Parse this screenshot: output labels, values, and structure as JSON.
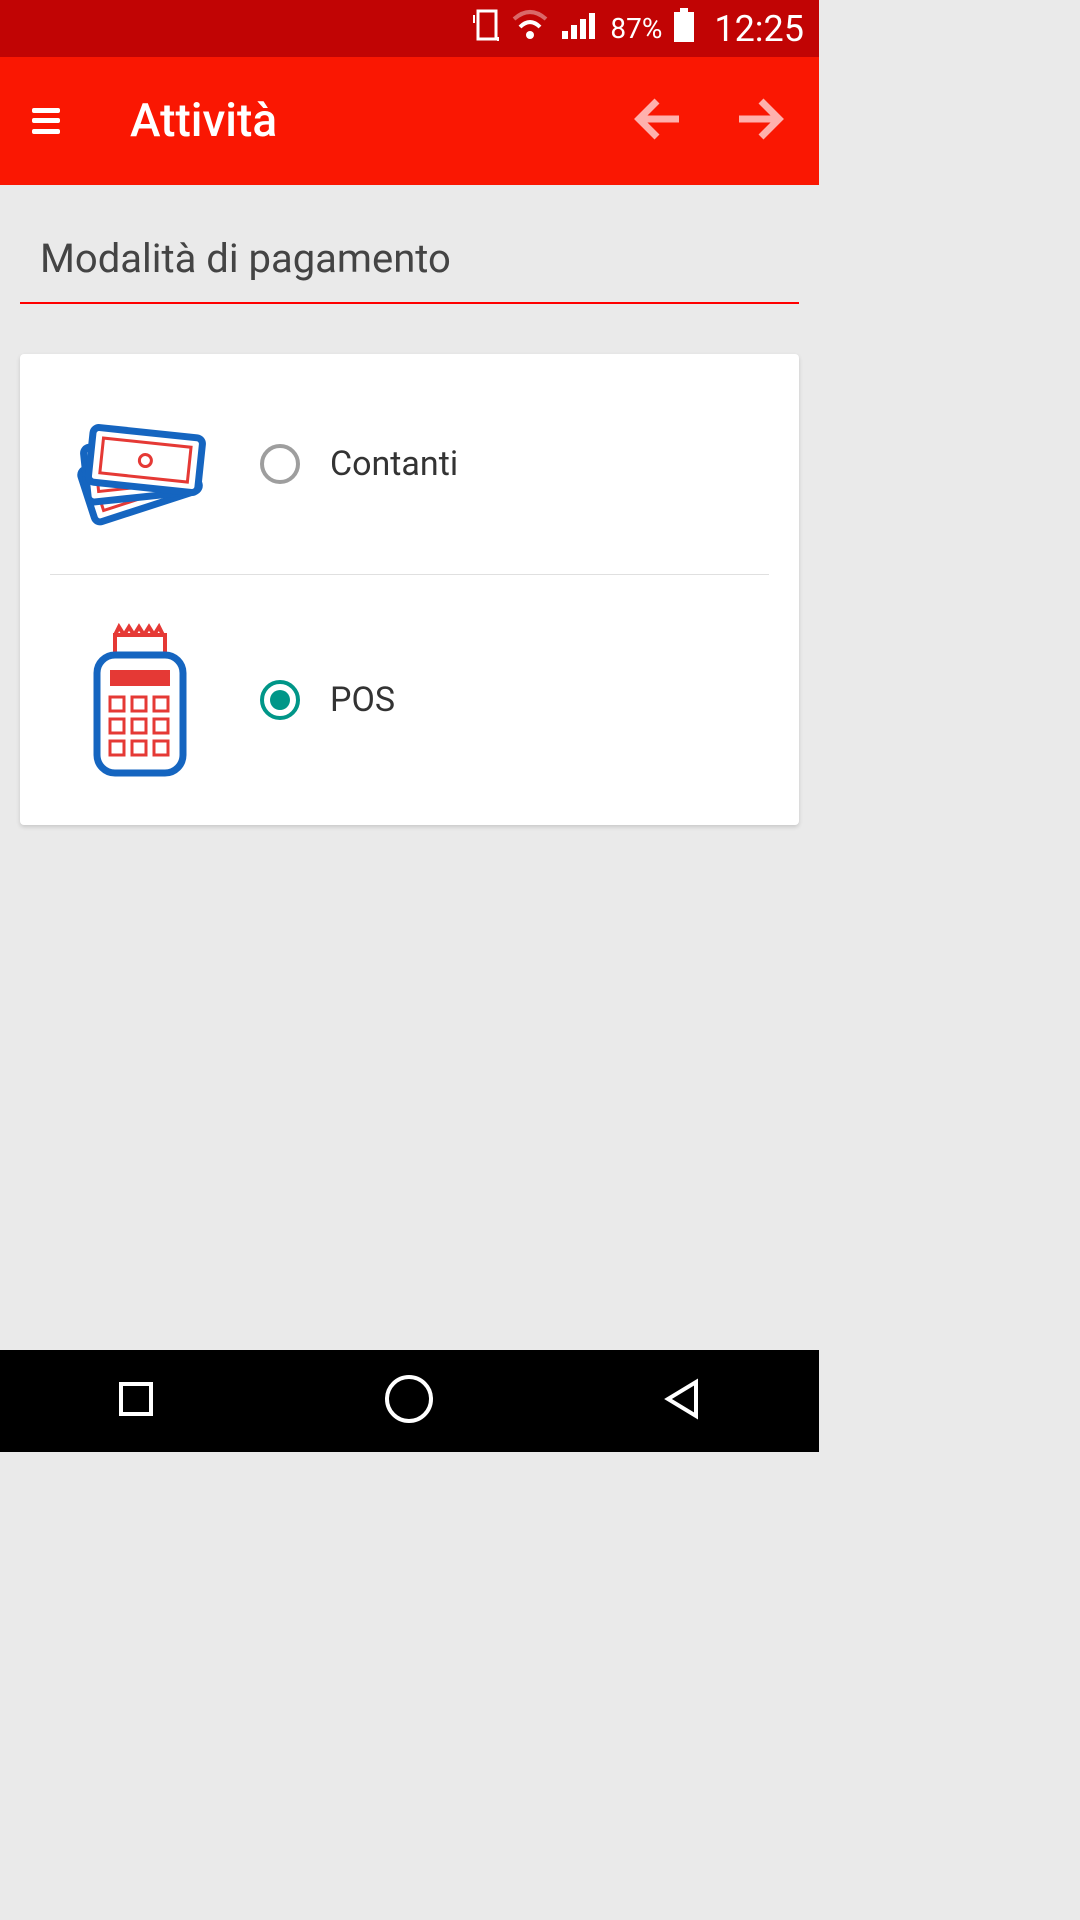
{
  "status": {
    "battery": "87%",
    "time": "12:25"
  },
  "header": {
    "title": "Attività"
  },
  "section": {
    "title": "Modalità di pagamento"
  },
  "options": {
    "cash": {
      "label": "Contanti",
      "selected": false
    },
    "pos": {
      "label": "POS",
      "selected": true
    }
  }
}
